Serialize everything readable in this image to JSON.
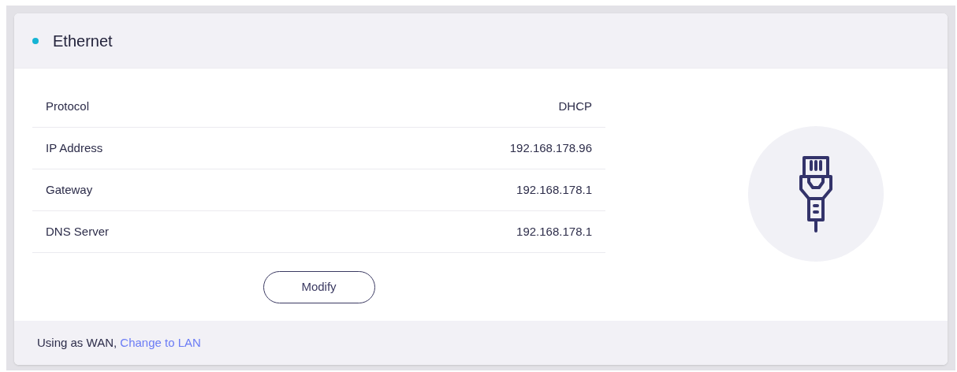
{
  "card": {
    "title": "Ethernet"
  },
  "rows": [
    {
      "label": "Protocol",
      "value": "DHCP"
    },
    {
      "label": "IP Address",
      "value": "192.168.178.96"
    },
    {
      "label": "Gateway",
      "value": "192.168.178.1"
    },
    {
      "label": "DNS Server",
      "value": "192.168.178.1"
    }
  ],
  "button": "Modify",
  "footer": {
    "text": "Using as WAN,",
    "link": "Change to LAN"
  }
}
